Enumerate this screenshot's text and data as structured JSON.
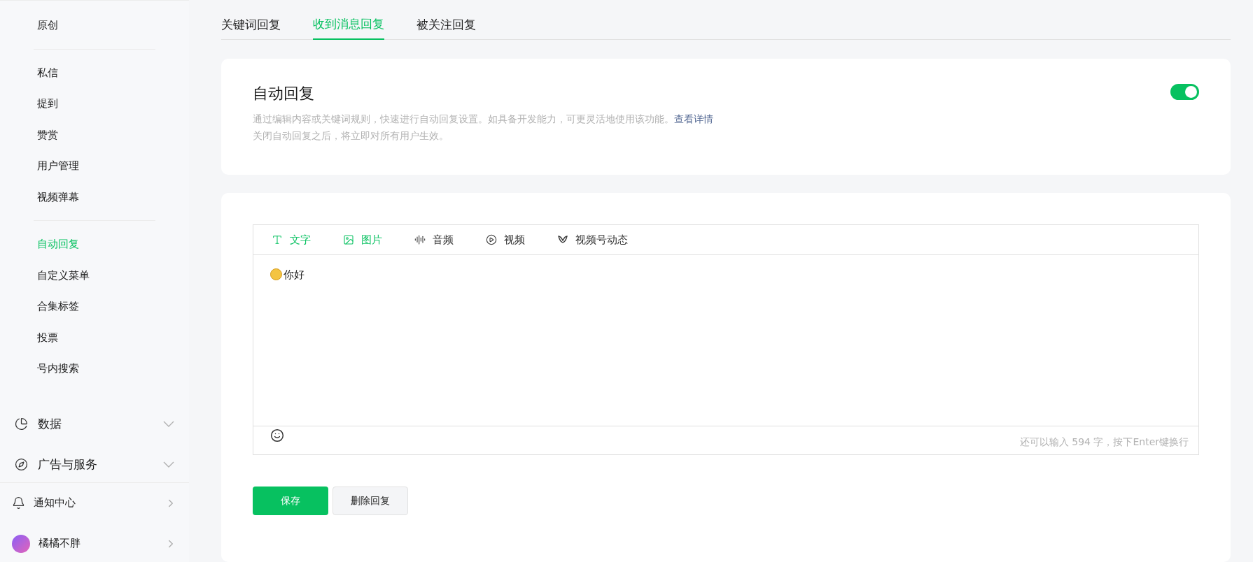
{
  "sidebar": {
    "groups": [
      {
        "items": [
          {
            "label": "原创",
            "selected": false
          }
        ]
      },
      {
        "items": [
          {
            "label": "私信",
            "selected": false
          },
          {
            "label": "提到",
            "selected": false
          },
          {
            "label": "赞赏",
            "selected": false
          },
          {
            "label": "用户管理",
            "selected": false
          },
          {
            "label": "视频弹幕",
            "selected": false
          }
        ]
      },
      {
        "items": [
          {
            "label": "自动回复",
            "selected": true
          },
          {
            "label": "自定义菜单",
            "selected": false
          },
          {
            "label": "合集标签",
            "selected": false
          },
          {
            "label": "投票",
            "selected": false
          },
          {
            "label": "号内搜索",
            "selected": false
          }
        ]
      }
    ],
    "sections": [
      {
        "label": "数据",
        "kind": "chart",
        "expanded": false
      },
      {
        "label": "广告与服务",
        "kind": "compass",
        "expanded": false
      }
    ],
    "footer": [
      {
        "label": "通知中心",
        "kind": "bell"
      },
      {
        "label": "橘橘不胖",
        "kind": "avatar"
      }
    ]
  },
  "tabs": [
    {
      "label": "关键词回复",
      "selected": false
    },
    {
      "label": "收到消息回复",
      "selected": true
    },
    {
      "label": "被关注回复",
      "selected": false
    }
  ],
  "auto_reply": {
    "title": "自动回复",
    "on": true,
    "description": "通过编辑内容或关键词规则，快速进行自动回复设置。如具备开发能力，可更灵活地使用该功能。",
    "link": "查看详情",
    "note": "关闭自动回复之后，将立即对所有用户生效。"
  },
  "editor": {
    "types": [
      {
        "label": "文字",
        "kind": "text",
        "active": true
      },
      {
        "label": "图片",
        "kind": "image",
        "active": true
      },
      {
        "label": "音频",
        "kind": "audio",
        "active": false
      },
      {
        "label": "视频",
        "kind": "video",
        "active": false
      },
      {
        "label": "视频号动态",
        "kind": "channels",
        "active": false
      }
    ],
    "content": "你好",
    "counter": "还可以输入 594 字，按下Enter键换行"
  },
  "buttons": [
    {
      "label": "保存",
      "kind": "primary"
    },
    {
      "label": "删除回复",
      "kind": "secondary"
    }
  ]
}
